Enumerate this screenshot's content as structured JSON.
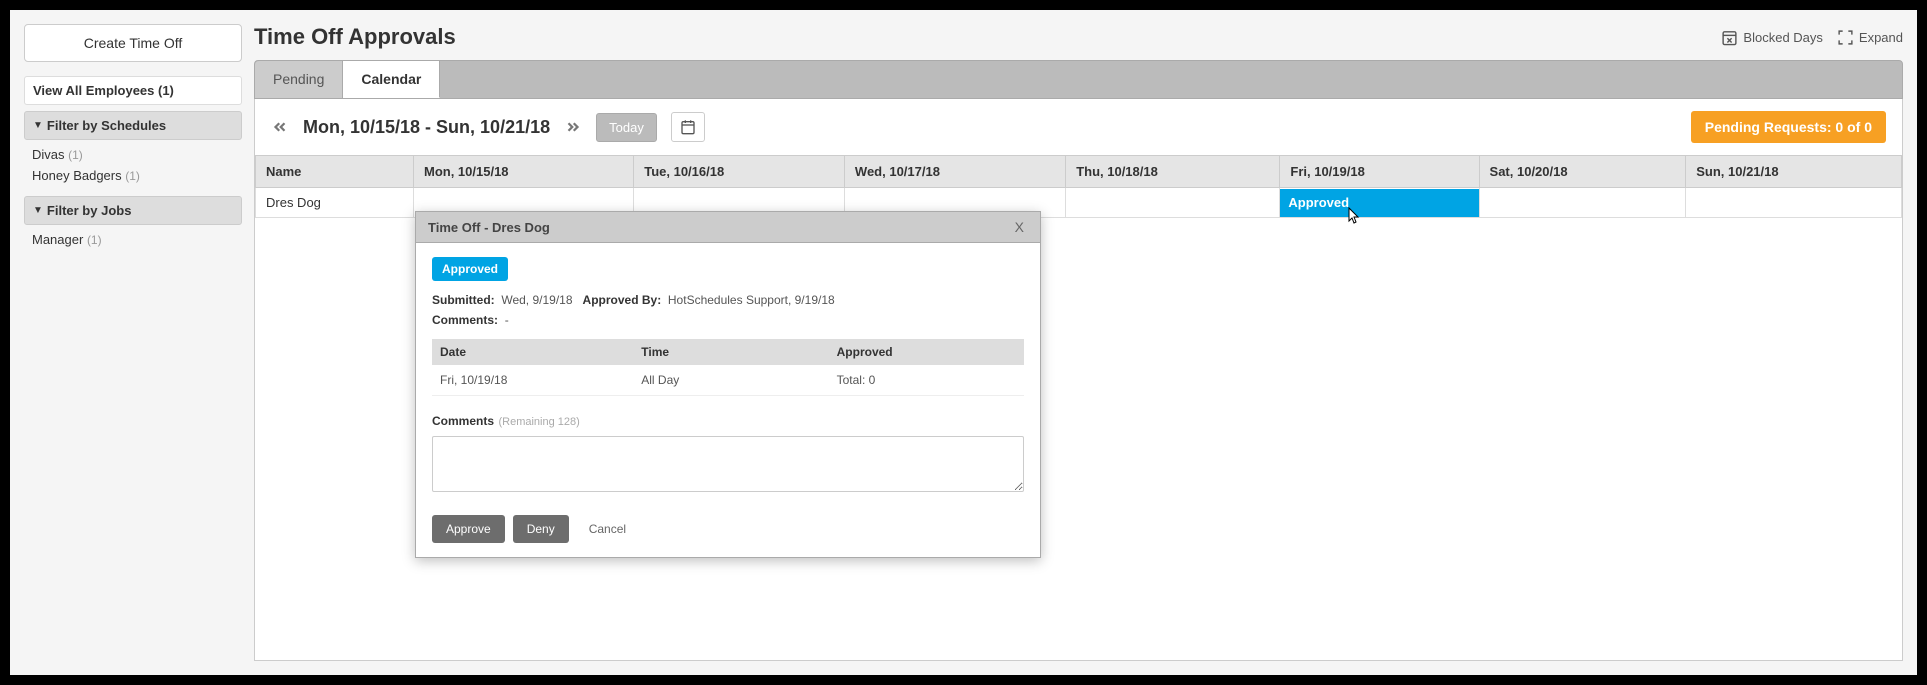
{
  "sidebar": {
    "create_label": "Create Time Off",
    "view_all_label": "View All Employees (1)",
    "filter_schedules_label": "Filter by Schedules",
    "schedules": [
      {
        "name": "Divas",
        "count": "(1)"
      },
      {
        "name": "Honey Badgers",
        "count": "(1)"
      }
    ],
    "filter_jobs_label": "Filter by Jobs",
    "jobs": [
      {
        "name": "Manager",
        "count": "(1)"
      }
    ]
  },
  "header": {
    "title": "Time Off Approvals",
    "blocked_days": "Blocked Days",
    "expand": "Expand"
  },
  "tabs": {
    "pending": "Pending",
    "calendar": "Calendar"
  },
  "calendar": {
    "date_range": "Mon, 10/15/18 - Sun, 10/21/18",
    "today": "Today",
    "pending_badge": "Pending Requests: 0 of 0",
    "columns": [
      "Name",
      "Mon, 10/15/18",
      "Tue, 10/16/18",
      "Wed, 10/17/18",
      "Thu, 10/18/18",
      "Fri, 10/19/18",
      "Sat, 10/20/18",
      "Sun, 10/21/18"
    ],
    "row_name": "Dres Dog",
    "approved_text": "Approved"
  },
  "modal": {
    "title": "Time Off - Dres Dog",
    "close": "X",
    "status": "Approved",
    "submitted_label": "Submitted:",
    "submitted_value": "Wed, 9/19/18",
    "approved_by_label": "Approved By:",
    "approved_by_value": "HotSchedules Support, 9/19/18",
    "comments_label": "Comments:",
    "comments_value": "-",
    "table": {
      "headers": [
        "Date",
        "Time",
        "Approved"
      ],
      "date": "Fri, 10/19/18",
      "time": "All Day",
      "approved": "Total: 0"
    },
    "new_comments_label": "Comments",
    "remaining": "(Remaining 128)",
    "approve_btn": "Approve",
    "deny_btn": "Deny",
    "cancel_btn": "Cancel"
  }
}
